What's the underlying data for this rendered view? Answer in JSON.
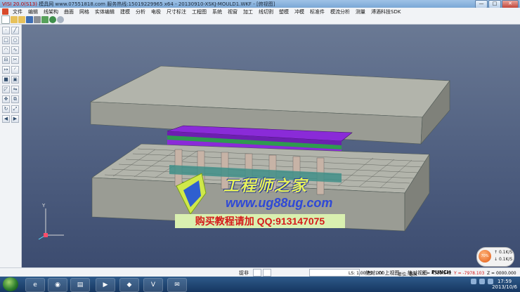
{
  "window": {
    "title_prefix": "VISI 20.0(S13)",
    "title_main": " 模具网 www.07551818.com 服务热线:15019229965 x64 - 20130910-XSKJ-MOULD1.WKF - [俯视图]",
    "buttons": {
      "minimize": "—",
      "maximize": "□",
      "close": "✕"
    }
  },
  "menu": [
    "文件",
    "编辑",
    "线架构",
    "曲面",
    "网格",
    "实体编辑",
    "建模",
    "分析",
    "电极",
    "尺寸标注",
    "工程图",
    "系统",
    "视窗",
    "加工",
    "线切割",
    "塑模",
    "冲模",
    "标准件",
    "模流分析",
    "测量",
    "溥酒科技SDK"
  ],
  "toolbar_icons": [
    "new-file-icon",
    "open-folder-icon",
    "save-icon",
    "print-icon",
    "undo-icon",
    "redo-icon",
    "layer-icon",
    "help-icon"
  ],
  "sidebar_icons": [
    "point",
    "line",
    "rect",
    "circle",
    "arc",
    "spline",
    "offset",
    "trim",
    "extend",
    "fillet",
    "chamfer",
    "mirror",
    "move",
    "copy",
    "rotate",
    "scale",
    "arrow-left",
    "arrow-right"
  ],
  "watermark": {
    "brand": "工程师之家",
    "url": "www.ug88ug.com",
    "contact": "购买教程请加 QQ:913147075"
  },
  "axis": {
    "y": "Y",
    "x": "X"
  },
  "status": {
    "labels": [
      "捉非",
      "绝对 XY 上视图",
      "绝对视图",
      "PUNCH"
    ],
    "ls": "LS: 1.00 PS: 1.00",
    "unit": "单位: 毫米",
    "x": "X = 4339.642",
    "y": "Y = -7978.103",
    "z": "Z = 0000.000"
  },
  "network": {
    "percent": "70%",
    "up": "0.1K/S",
    "down": "0.1K/S"
  },
  "clock": {
    "time": "17:59",
    "date": "2013/10/6"
  },
  "colors": {
    "plate_top": "#a7a9a0",
    "plate_side": "#8e9089",
    "purple": "#8a2bd8",
    "green": "#2f9a4f",
    "teal": "#3f8f88"
  }
}
